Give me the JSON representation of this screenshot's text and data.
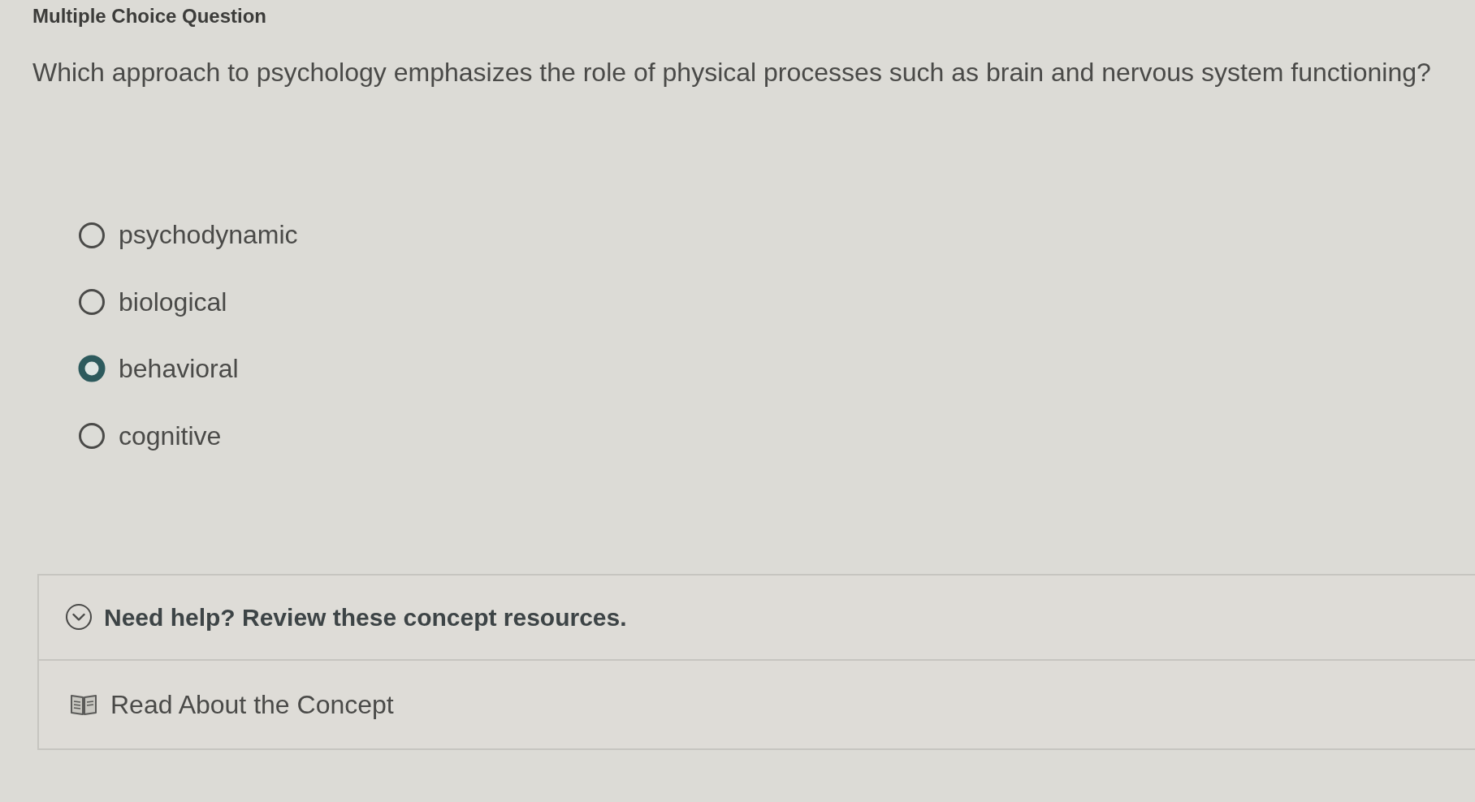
{
  "header": {
    "title": "Multiple Choice Question"
  },
  "question": {
    "text": "Which approach to psychology emphasizes the role of physical processes such as brain and nervous system functioning?",
    "options": [
      {
        "label": "psychodynamic",
        "selected": false
      },
      {
        "label": "biological",
        "selected": false
      },
      {
        "label": "behavioral",
        "selected": true
      },
      {
        "label": "cognitive",
        "selected": false
      }
    ]
  },
  "help": {
    "title": "Need help? Review these concept resources.",
    "expanded": true,
    "resources": [
      {
        "label": "Read About the Concept"
      }
    ]
  }
}
